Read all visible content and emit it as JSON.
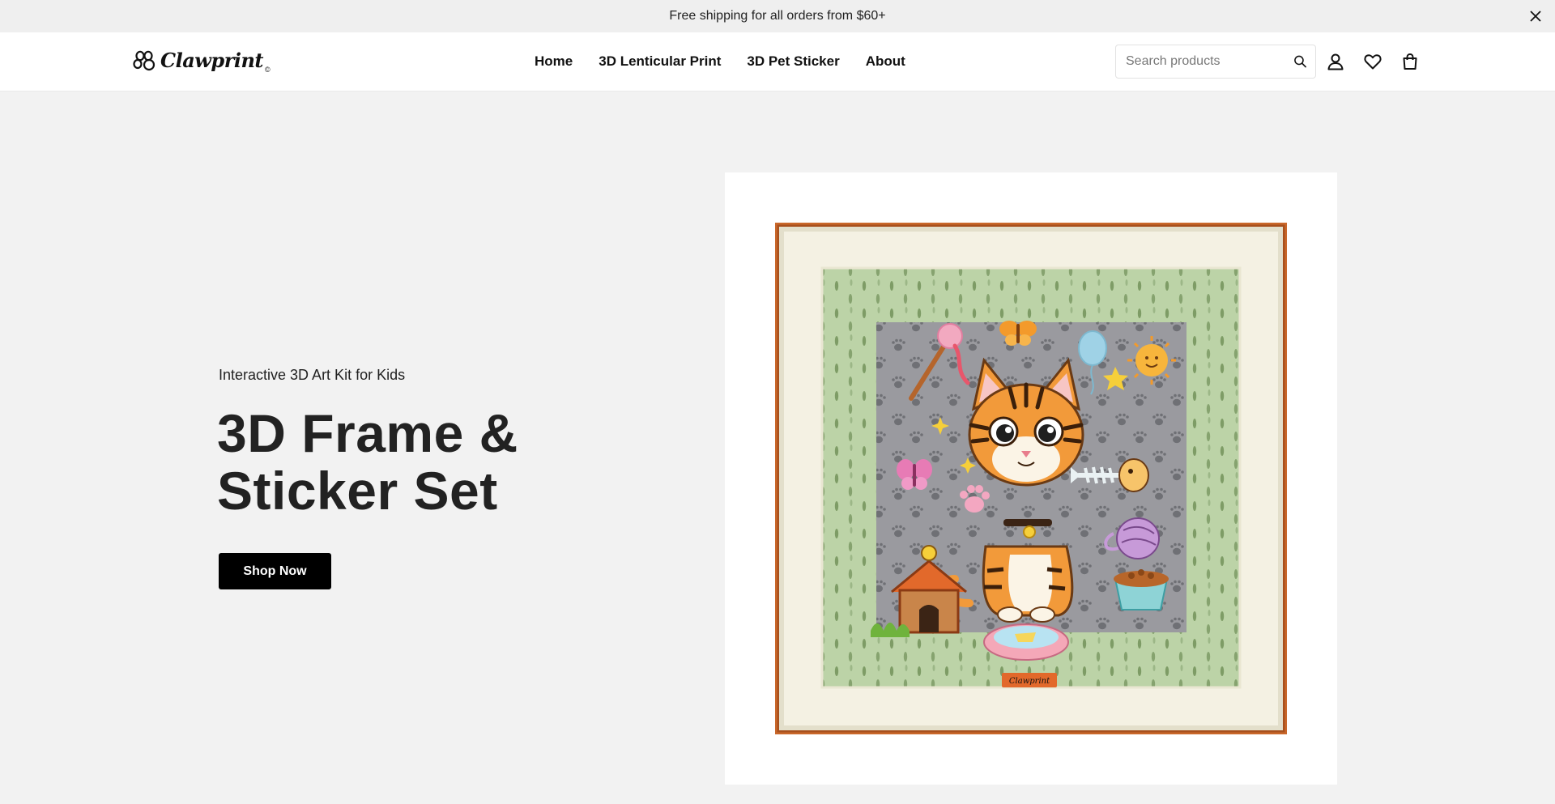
{
  "announcement": {
    "text": "Free shipping for all orders from $60+"
  },
  "brand": {
    "name": "Clawprint",
    "mark": "©",
    "plaque_text": "Clawprint"
  },
  "nav": {
    "items": [
      {
        "label": "Home"
      },
      {
        "label": "3D Lenticular Print"
      },
      {
        "label": "3D Pet Sticker"
      },
      {
        "label": "About"
      }
    ]
  },
  "search": {
    "placeholder": "Search products",
    "value": ""
  },
  "header_icons": [
    "search-icon",
    "account-icon",
    "wishlist-heart-icon",
    "cart-bag-icon"
  ],
  "hero": {
    "subtitle": "Interactive 3D Art Kit for Kids",
    "title": "3D Frame & Sticker Set",
    "cta_label": "Shop Now"
  },
  "colors": {
    "background": "#f2f2f2",
    "announcement_bg": "#efefef",
    "button_bg": "#000000",
    "button_text": "#ffffff",
    "frame_wood": "#c9672a",
    "mat": "#f4f1e3",
    "backdrop_green": "#b8cfa4"
  }
}
